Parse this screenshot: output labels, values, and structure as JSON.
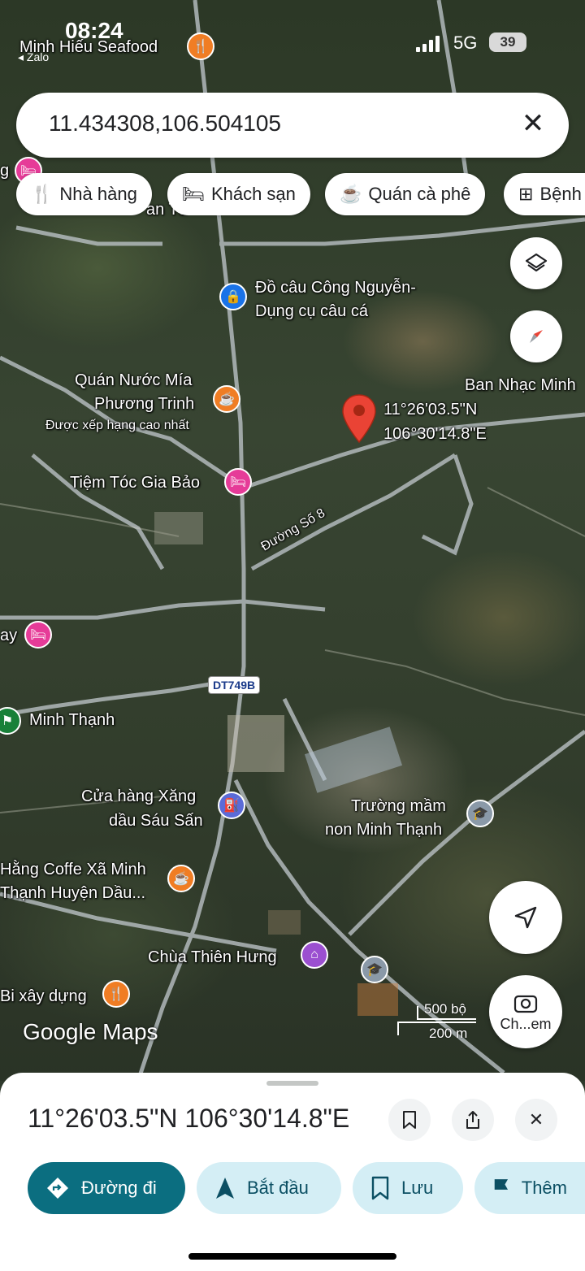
{
  "status_bar": {
    "time": "08:24",
    "back_app": "◂ Zalo",
    "network": "5G",
    "battery": "39"
  },
  "search": {
    "query": "11.434308,106.504105",
    "clear_icon": "close-icon"
  },
  "chips": [
    {
      "label": "Nhà hàng",
      "icon": "restaurant-icon"
    },
    {
      "label": "Khách sạn",
      "icon": "hotel-icon"
    },
    {
      "label": "Quán cà phê",
      "icon": "coffee-icon"
    },
    {
      "label": "Bệnh",
      "icon": "hospital-icon"
    }
  ],
  "map": {
    "labels": {
      "minh_hieu": "Minh Hiếu Seafood",
      "partial_top": "an Tú",
      "do_cau_1": "Đồ câu Công Nguyễn-",
      "do_cau_2": "Dụng cụ câu cá",
      "ban_nhac": "Ban Nhạc Minh",
      "quan_nuoc_1": "Quán Nước Mía",
      "quan_nuoc_2": "Phương Trinh",
      "quan_nuoc_3": "Được xếp hạng cao nhất",
      "pin_coord_1": "11°26'03.5\"N",
      "pin_coord_2": "106°30'14.8\"E",
      "tiem_toc": "Tiệm Tóc Gia Bảo",
      "duong_so_8": "Đường Số 8",
      "partial_ay": "ay",
      "dt749b": "DT749B",
      "minh_thanh": "Minh Thạnh",
      "xang_1": "Cửa hàng Xăng",
      "xang_2": "dầu Sáu Sấn",
      "truong_1": "Trường mầm",
      "truong_2": "non Minh Thạnh",
      "coffe_1": "Hằng Coffe Xã Minh",
      "coffe_2": "Thạnh Huyện Dầu...",
      "chua": "Chùa Thiên Hưng",
      "vlxd": "Bi xây dựng",
      "partial_g": "g"
    },
    "scale": {
      "feet": "500 bộ",
      "meters": "200 m"
    },
    "attribution": "Google Maps",
    "lens_label": "Ch...em"
  },
  "sheet": {
    "coords": "11°26'03.5\"N 106°30'14.8\"E",
    "actions": [
      {
        "label": "Đường đi",
        "icon": "directions-icon"
      },
      {
        "label": "Bắt đầu",
        "icon": "navigation-icon"
      },
      {
        "label": "Lưu",
        "icon": "bookmark-icon"
      },
      {
        "label": "Thêm",
        "icon": "flag-icon"
      }
    ]
  },
  "colors": {
    "primary_action": "#0b6e80",
    "secondary_action": "#d4eef5",
    "pin": "#ea4335"
  }
}
